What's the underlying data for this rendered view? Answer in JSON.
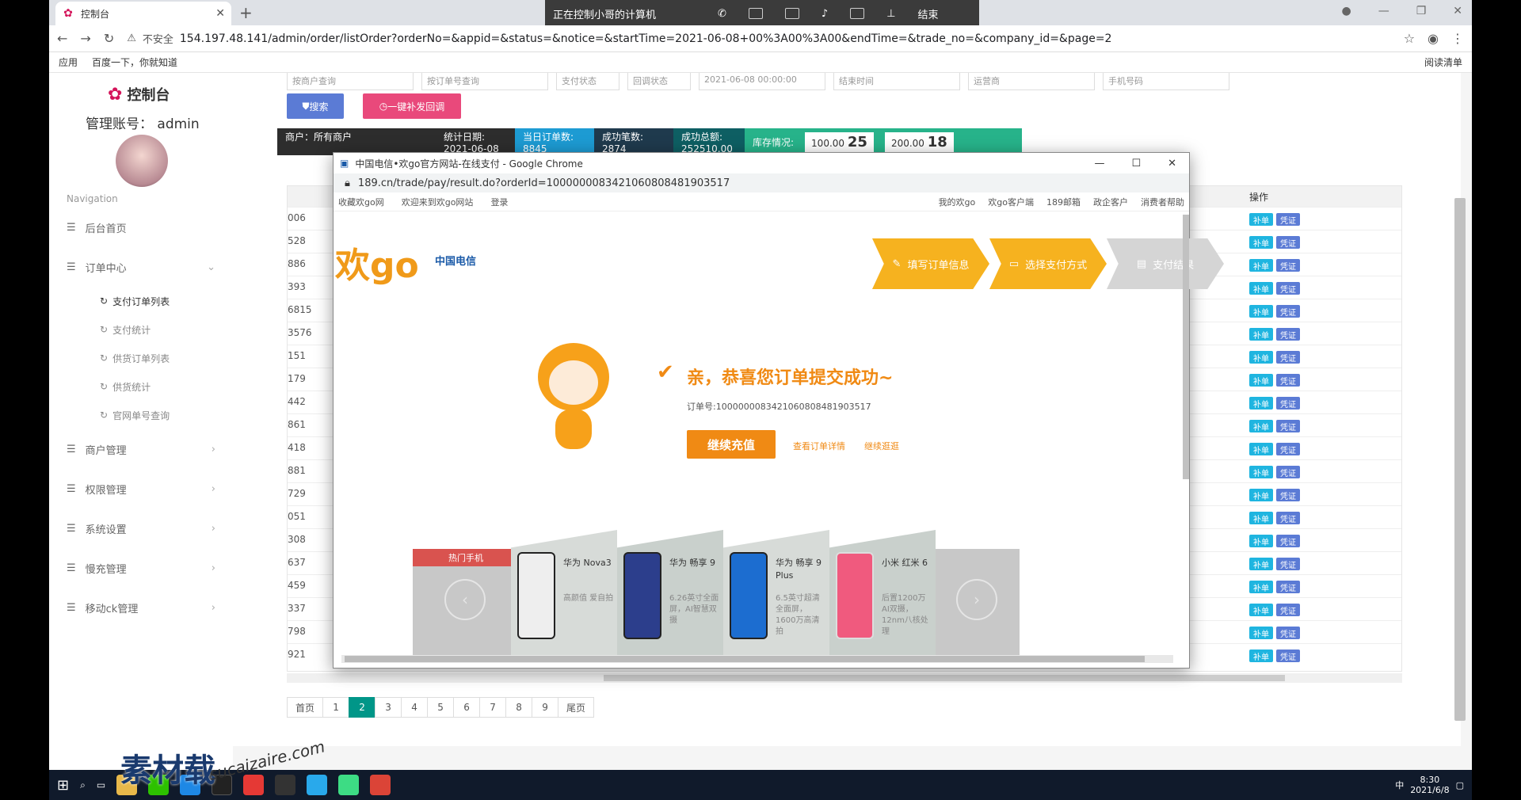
{
  "browser": {
    "tab_title": "控制台",
    "url": "154.197.48.141/admin/order/listOrder?orderNo=&appid=&status=&notice=&startTime=2021-06-08+00%3A00%3A00&endTime=&trade_no=&company_id=&page=2",
    "insecure_label": "不安全",
    "bookmarks": [
      "应用",
      "百度一下，你就知道"
    ],
    "reading_list": "阅读清单"
  },
  "remote_bar": {
    "title": "正在控制小哥的计算机",
    "end": "结束"
  },
  "sidebar": {
    "logo": "控制台",
    "account_label": "管理账号：",
    "account_name": "admin",
    "nav_label": "Navigation",
    "items": [
      {
        "label": "后台首页"
      },
      {
        "label": "订单中心"
      }
    ],
    "sub_items": [
      "支付订单列表",
      "支付统计",
      "供货订单列表",
      "供货统计",
      "官网单号查询"
    ],
    "items2": [
      "商户管理",
      "权限管理",
      "系统设置",
      "慢充管理",
      "移动ck管理"
    ]
  },
  "main": {
    "filters": [
      "按商户查询",
      "按订单号查询",
      "支付状态",
      "回调状态",
      "2021-06-08 00:00:00",
      "结束时间",
      "运营商",
      "手机号码"
    ],
    "search_btn": "搜索",
    "resend_btn": "一键补发回调",
    "stats": {
      "merchant": "商户：所有商户",
      "date_label": "统计日期:",
      "date": "2021-06-08",
      "today_label": "当日订单数:",
      "today": "8845",
      "success_label": "成功笔数: 2874",
      "total_label": "成功总额:",
      "total": "252510.00",
      "stock_label": "库存情况:",
      "stock": [
        {
          "face": "100.00",
          "count": "25"
        },
        {
          "face": "200.00",
          "count": "18"
        }
      ]
    },
    "ops_header": "操作",
    "rows": [
      "006",
      "528",
      "886",
      "393",
      "6815",
      "3576",
      "151",
      "179",
      "442",
      "861",
      "418",
      "881",
      "729",
      "051",
      "308",
      "637",
      "459",
      "337",
      "798",
      "921"
    ],
    "btn_fix": "补单",
    "btn_proof": "凭证",
    "pager": [
      "首页",
      "1",
      "2",
      "3",
      "4",
      "5",
      "6",
      "7",
      "8",
      "9",
      "尾页"
    ],
    "current_page": "2"
  },
  "popup": {
    "title": "中国电信•欢go官方网站-在线支付 - Google Chrome",
    "url": "189.cn/trade/pay/result.do?orderId=100000008342106080848190351​7",
    "top_links": [
      "收藏欢go网",
      "欢迎来到欢go网站",
      "登录"
    ],
    "top_right": [
      "我的欢go",
      "欢go客户端",
      "189邮箱",
      "政企客户",
      "消费者帮助"
    ],
    "brand": "欢go",
    "telecom": "中国电信",
    "steps": [
      "填写订单信息",
      "选择支付方式",
      "支付结果"
    ],
    "success": "亲，恭喜您订单提交成功~",
    "order_no": "订单号:1000000083421060808481903517",
    "continue_btn": "继续充值",
    "view_detail": "查看订单详情",
    "continue_shop": "继续逛逛",
    "hot_label": "热门手机",
    "phones": [
      {
        "name": "华为 Nova3",
        "desc": "高颜值 爱自拍"
      },
      {
        "name": "华为 畅享 9",
        "desc": "6.26英寸全面屏，AI智慧双摄"
      },
      {
        "name": "华为 畅享 9 Plus",
        "desc": "6.5英寸超清全面屏，1600万高清拍"
      },
      {
        "name": "小米 红米 6",
        "desc": "后置1200万 AI双摄，12nm八核处理"
      }
    ]
  },
  "taskbar": {
    "time": "8:30",
    "date": "2021/6/8",
    "ime": "中"
  },
  "watermark": {
    "text": "素材载",
    "url": "sucaizaire.com"
  }
}
